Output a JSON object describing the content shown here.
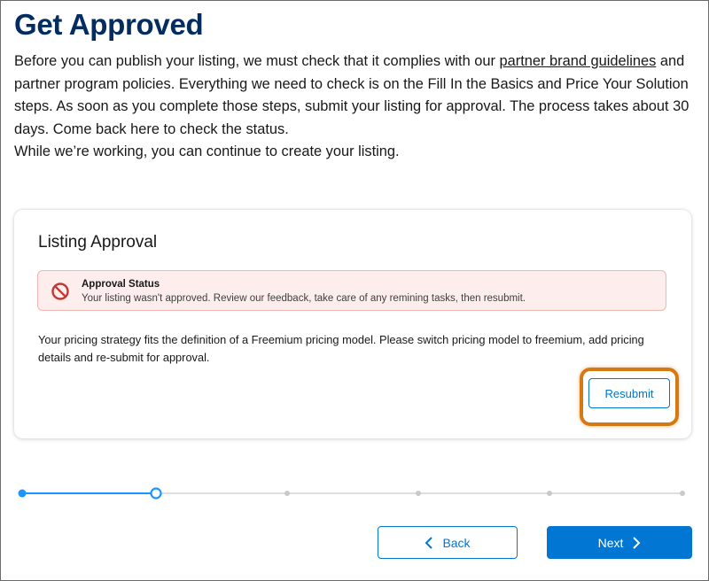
{
  "page": {
    "title": "Get Approved",
    "intro_part1": "Before you can publish your listing, we must check that it complies with our ",
    "intro_link": "partner brand guidelines",
    "intro_part2": " and partner program policies. Everything we need to check is on the Fill In the Basics and Price Your Solution steps. As soon as you complete those steps, submit your listing for approval. The process takes about 30 days. Come back here to check the status.",
    "intro_line2": "While we’re working, you can continue to create your listing."
  },
  "card": {
    "title": "Listing Approval",
    "alert": {
      "icon": "ban-icon",
      "heading": "Approval Status",
      "text": "Your listing wasn't approved. Review our feedback, take care of any remining tasks, then resubmit."
    },
    "body": "Your pricing strategy fits the definition of a Freemium pricing model. Please switch pricing model to freemium, add pricing details and re-submit for approval.",
    "resubmit_label": "Resubmit",
    "highlight_color": "#d57a12"
  },
  "stepper": {
    "total_steps": 6,
    "completed_steps": 1,
    "current_step": 2
  },
  "footer": {
    "back_label": "Back",
    "next_label": "Next"
  },
  "colors": {
    "brand_blue": "#0176d3",
    "title_navy": "#032d60",
    "error_red": "#c23934"
  }
}
